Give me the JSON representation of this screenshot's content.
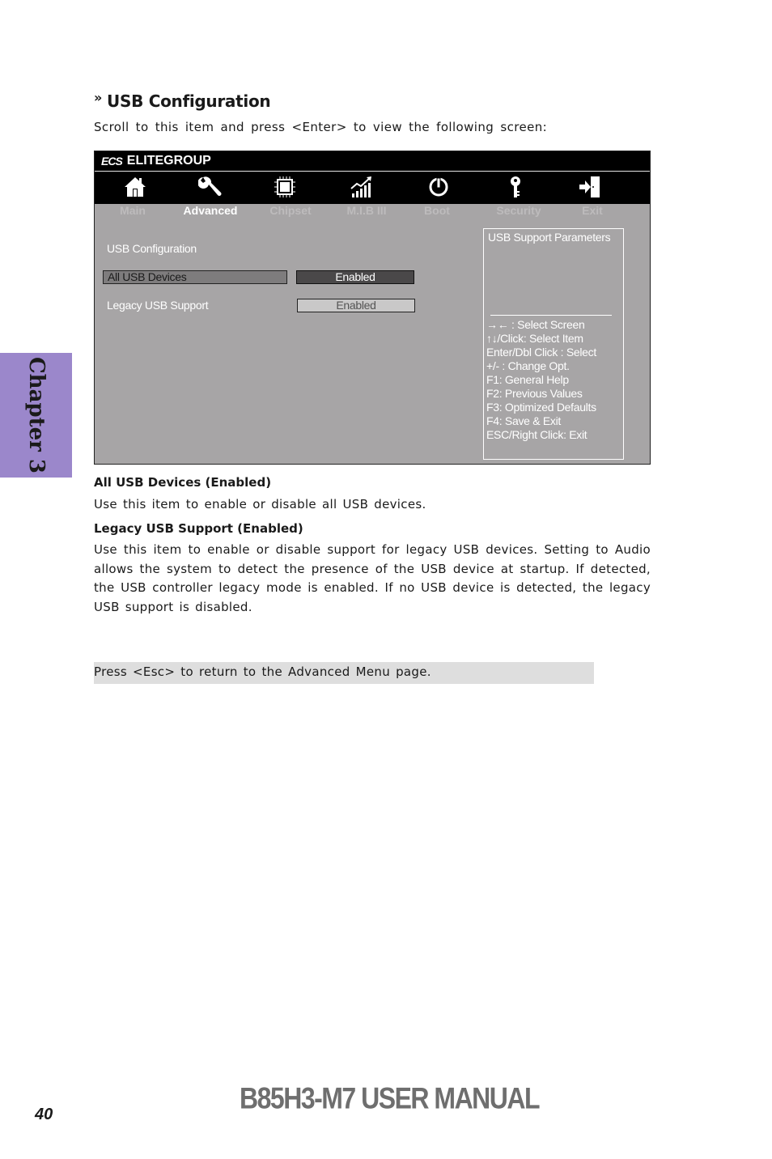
{
  "section": {
    "chevron_icon": "»",
    "title": "USB Configuration",
    "intro": "Scroll to this item and press <Enter> to view the following screen:"
  },
  "bios": {
    "brand_logo": "ECS",
    "brand_name": "ELITEGROUP",
    "tabs": [
      {
        "label": "Main",
        "icon": "home-icon",
        "active": false
      },
      {
        "label": "Advanced",
        "icon": "wrench-icon",
        "active": true
      },
      {
        "label": "Chipset",
        "icon": "chip-icon",
        "active": false
      },
      {
        "label": "M.I.B III",
        "icon": "chart-growth-icon",
        "active": false
      },
      {
        "label": "Boot",
        "icon": "power-icon",
        "active": false
      },
      {
        "label": "Security",
        "icon": "key-icon",
        "active": false
      },
      {
        "label": "Exit",
        "icon": "exit-door-icon",
        "active": false
      }
    ],
    "page_title": "USB Configuration",
    "items": [
      {
        "label": "All USB Devices",
        "value": "Enabled",
        "selected": true
      },
      {
        "label": "Legacy USB Support",
        "value": "Enabled",
        "selected": false
      }
    ],
    "help": {
      "title": "USB Support Parameters",
      "keys": [
        "→←   : Select Screen",
        "↑↓/Click: Select Item",
        "Enter/Dbl Click : Select",
        "+/- : Change Opt.",
        "F1: General Help",
        "F2: Previous Values",
        "F3: Optimized Defaults",
        "F4: Save & Exit",
        "ESC/Right Click: Exit"
      ]
    }
  },
  "chapter_tab": "Chapter 3",
  "descriptions": [
    {
      "heading": "All USB Devices (Enabled)",
      "text": "Use this item to enable or disable all USB devices."
    },
    {
      "heading": "Legacy USB Support (Enabled)",
      "text": "Use this item to enable or disable support for legacy USB devices. Setting to Audio allows the system to detect the presence of the USB device at startup. If detected, the USB controller legacy mode is enabled. If no USB device is detected, the legacy USB support is disabled."
    }
  ],
  "note": "Press <Esc> to return to the Advanced Menu page.",
  "footer": {
    "title": "B85H3-M7 USER MANUAL",
    "page_number": "40"
  }
}
